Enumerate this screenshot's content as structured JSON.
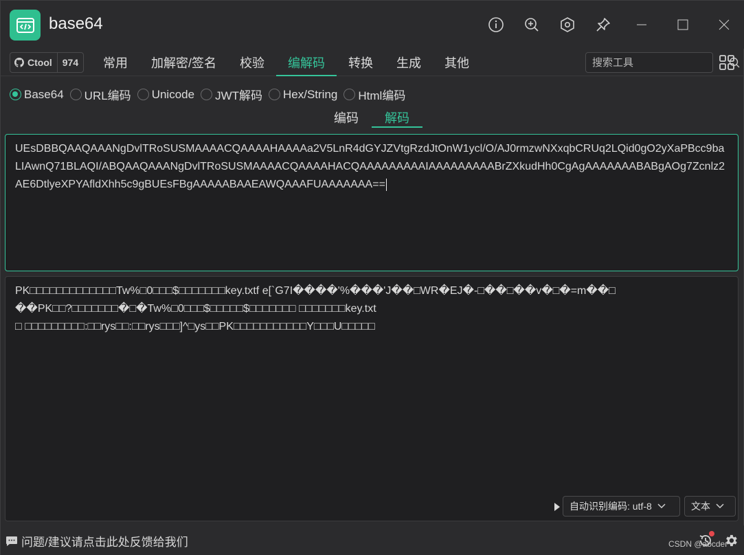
{
  "app": {
    "title": "base64",
    "accent_color": "#35c49a",
    "logo_icon": "code-window-icon"
  },
  "titlebar": {
    "icons": [
      "info-icon",
      "zoom-in-icon",
      "settings-hex-icon",
      "pin-icon"
    ],
    "window_controls": [
      "minimize-icon",
      "maximize-icon",
      "close-icon"
    ]
  },
  "nav": {
    "ctool_label": "Ctool",
    "ctool_count": "974",
    "tabs": [
      {
        "label": "常用"
      },
      {
        "label": "加解密/签名"
      },
      {
        "label": "校验"
      },
      {
        "label": "编解码"
      },
      {
        "label": "转换"
      },
      {
        "label": "生成"
      },
      {
        "label": "其他"
      }
    ],
    "active_tab": "编解码",
    "search_placeholder": "搜索工具"
  },
  "tools": {
    "options": [
      {
        "label": "Base64",
        "checked": true
      },
      {
        "label": "URL编码",
        "checked": false
      },
      {
        "label": "Unicode",
        "checked": false
      },
      {
        "label": "JWT解码",
        "checked": false
      },
      {
        "label": "Hex/String",
        "checked": false
      },
      {
        "label": "Html编码",
        "checked": false
      }
    ]
  },
  "subtabs": {
    "encode": "编码",
    "decode": "解码",
    "active": "解码"
  },
  "input": {
    "value": "UEsDBBQAAQAAANgDvlTRoSUSMAAAACQAAAAHAAAAa2V5LnR4dGYJZVtgRzdJtOnW1ycl/O/AJ0rmzwNXxqbCRUq2LQid0gO2yXaPBcc9baLIAwnQ71BLAQI/ABQAAQAAANgDvlTRoSUSMAAAACQAAAAHACQAAAAAAAAAIAAAAAAAAABrZXkudHh0CgAgAAAAAAABABgAOg7Zcnlz2AE6DtlyeXPYAfldXhh5c9gBUEsFBgAAAAABAAEAWQAAAFUAAAAAAA=="
  },
  "output": {
    "lines": [
      "PK□□□□□□□□□□□□□Tw%□0□□□$□□□□□□□key.txtf e[`G7I����'%���'J��□WR�EJ�-□��□��v�□�=m��□",
      "��PK□□?□□□□□□□�□�Tw%□0□□□$□□□□□$□□□□□□□ □□□□□□□key.txt",
      "□ □□□□□□□□□:□□rys□□:□□rys□□□]^□ys□□PK□□□□□□□□□□□Y□□□U□□□□□"
    ],
    "encoding_label": "自动识别编码: utf-8",
    "type_label": "文本"
  },
  "statusbar": {
    "feedback": "问题/建议请点击此处反馈给我们",
    "watermark": "CSDN @abcder"
  }
}
